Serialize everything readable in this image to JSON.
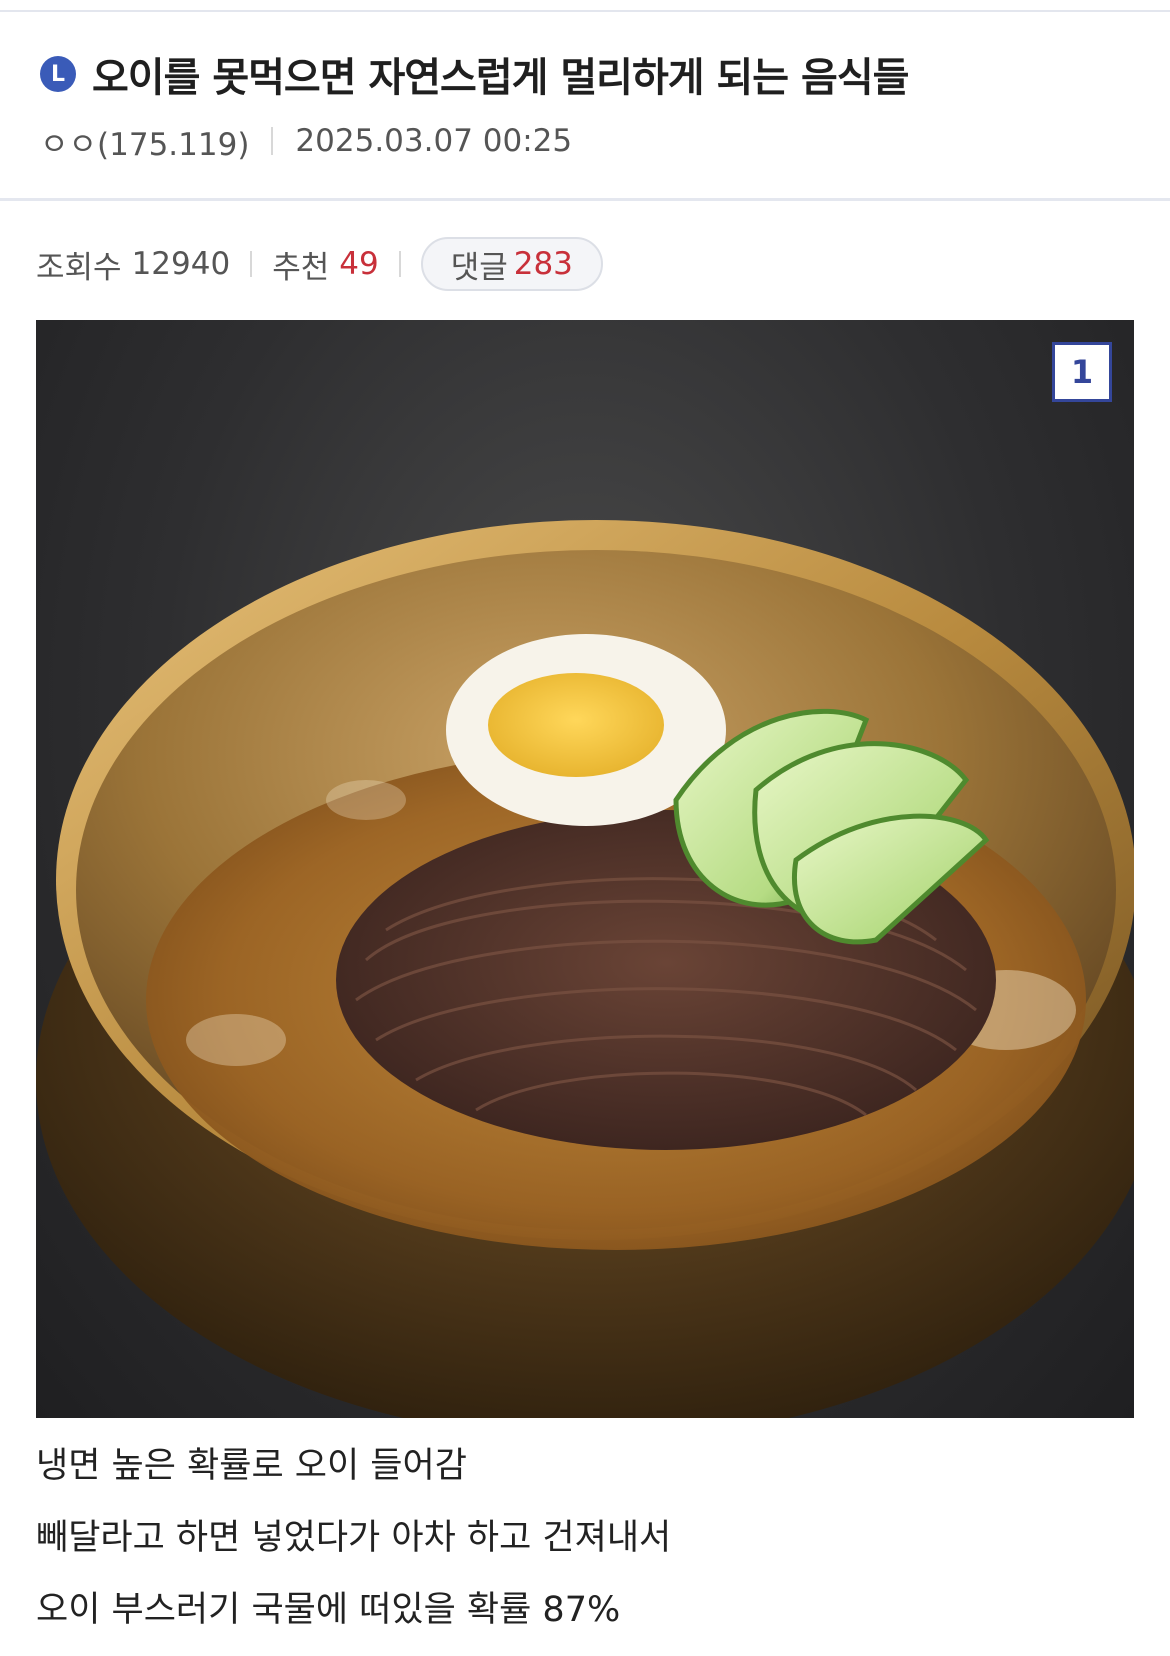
{
  "post": {
    "badge": "L",
    "title": "오이를 못먹으면 자연스럽게 멀리하게 되는 음식들",
    "author": "ㅇㅇ(175.119)",
    "datetime": "2025.03.07 00:25"
  },
  "stats": {
    "views_label": "조회수",
    "views_value": "12940",
    "recommend_label": "추천",
    "recommend_value": "49",
    "comments_label": "댓글",
    "comments_value": "283"
  },
  "image": {
    "index": "1",
    "description_icon": "naengmyeon-photo"
  },
  "content": {
    "lines": [
      "냉면 높은 확률로 오이 들어감",
      "빼달라고 하면 넣었다가 아차 하고 건져내서",
      "오이 부스러기 국물에 떠있을 확률 87%"
    ]
  },
  "colors": {
    "accent": "#3a5bb8",
    "count_red": "#c8303a",
    "divider": "#e4e7ef"
  }
}
